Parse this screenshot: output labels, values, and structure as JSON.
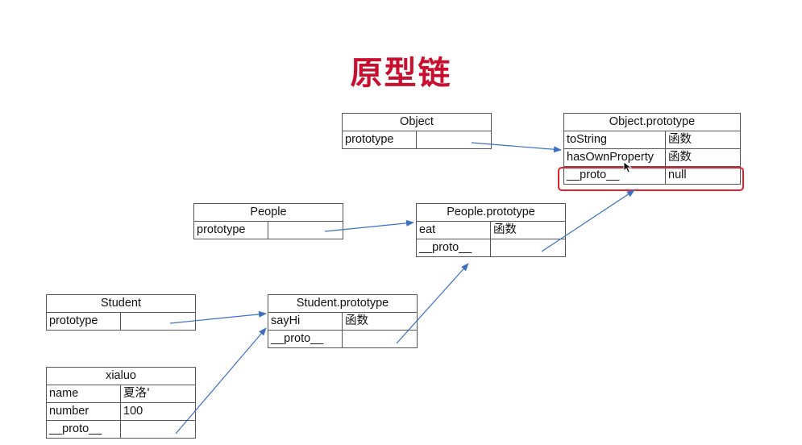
{
  "title": "原型链",
  "accent_color": "#c8102e",
  "arrow_color": "#3a6fc4",
  "highlight_color": "#e0222b",
  "tables": {
    "object": {
      "header": "Object",
      "rows": [
        {
          "key": "prototype",
          "value": ""
        }
      ]
    },
    "object_prototype": {
      "header": "Object.prototype",
      "rows": [
        {
          "key": "toString",
          "value": "函数"
        },
        {
          "key": "hasOwnProperty",
          "value": "函数"
        },
        {
          "key": "__proto__",
          "value": "null"
        }
      ]
    },
    "people": {
      "header": "People",
      "rows": [
        {
          "key": "prototype",
          "value": ""
        }
      ]
    },
    "people_prototype": {
      "header": "People.prototype",
      "rows": [
        {
          "key": "eat",
          "value": "函数"
        },
        {
          "key": "__proto__",
          "value": ""
        }
      ]
    },
    "student": {
      "header": "Student",
      "rows": [
        {
          "key": "prototype",
          "value": ""
        }
      ]
    },
    "student_prototype": {
      "header": "Student.prototype",
      "rows": [
        {
          "key": "sayHi",
          "value": "函数"
        },
        {
          "key": "__proto__",
          "value": ""
        }
      ]
    },
    "xialuo": {
      "header": "xialuo",
      "rows": [
        {
          "key": "name",
          "value": "夏洛'"
        },
        {
          "key": "number",
          "value": "100"
        },
        {
          "key": "__proto__",
          "value": ""
        }
      ]
    }
  },
  "arrows": [
    {
      "from": "object.prototype",
      "to": "object_prototype"
    },
    {
      "from": "people.prototype",
      "to": "people_prototype"
    },
    {
      "from": "student.prototype",
      "to": "student_prototype"
    },
    {
      "from": "xialuo.__proto__",
      "to": "student_prototype"
    },
    {
      "from": "student_prototype.__proto__",
      "to": "people_prototype"
    },
    {
      "from": "people_prototype.__proto__",
      "to": "object_prototype"
    }
  ],
  "highlighted_row": "object_prototype.__proto__"
}
